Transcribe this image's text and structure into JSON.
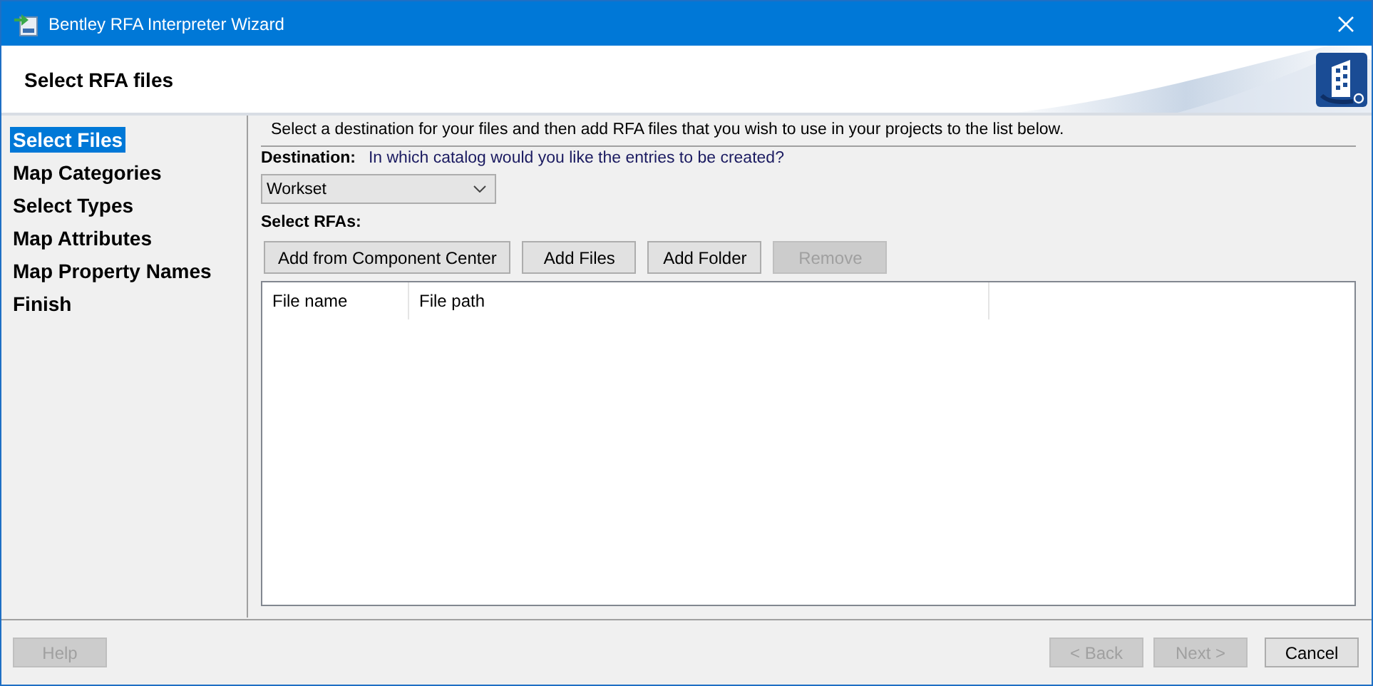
{
  "window": {
    "title": "Bentley RFA Interpreter Wizard"
  },
  "header": {
    "title": "Select RFA files"
  },
  "steps": [
    {
      "label": "Select Files",
      "selected": true
    },
    {
      "label": "Map Categories",
      "selected": false
    },
    {
      "label": "Select Types",
      "selected": false
    },
    {
      "label": "Map Attributes",
      "selected": false
    },
    {
      "label": "Map Property Names",
      "selected": false
    },
    {
      "label": "Finish",
      "selected": false
    }
  ],
  "instructions": "Select a destination for your files and then add RFA files that you wish to use in your projects to the list below.",
  "destination": {
    "label": "Destination:",
    "question": "In which catalog would you like the entries to be created?",
    "value": "Workset"
  },
  "select_label": "Select RFAs:",
  "actions": [
    {
      "label": "Add from Component Center",
      "disabled": false
    },
    {
      "label": "Add Files",
      "disabled": false
    },
    {
      "label": "Add Folder",
      "disabled": false
    },
    {
      "label": "Remove",
      "disabled": true
    }
  ],
  "table": {
    "columns": [
      "File name",
      "File path"
    ]
  },
  "footer": {
    "left": [
      {
        "label": "Help",
        "disabled": true
      }
    ],
    "right": [
      {
        "label": "< Back",
        "disabled": true
      },
      {
        "label": "Next >",
        "disabled": true
      },
      {
        "label": "Cancel",
        "disabled": false
      }
    ]
  }
}
